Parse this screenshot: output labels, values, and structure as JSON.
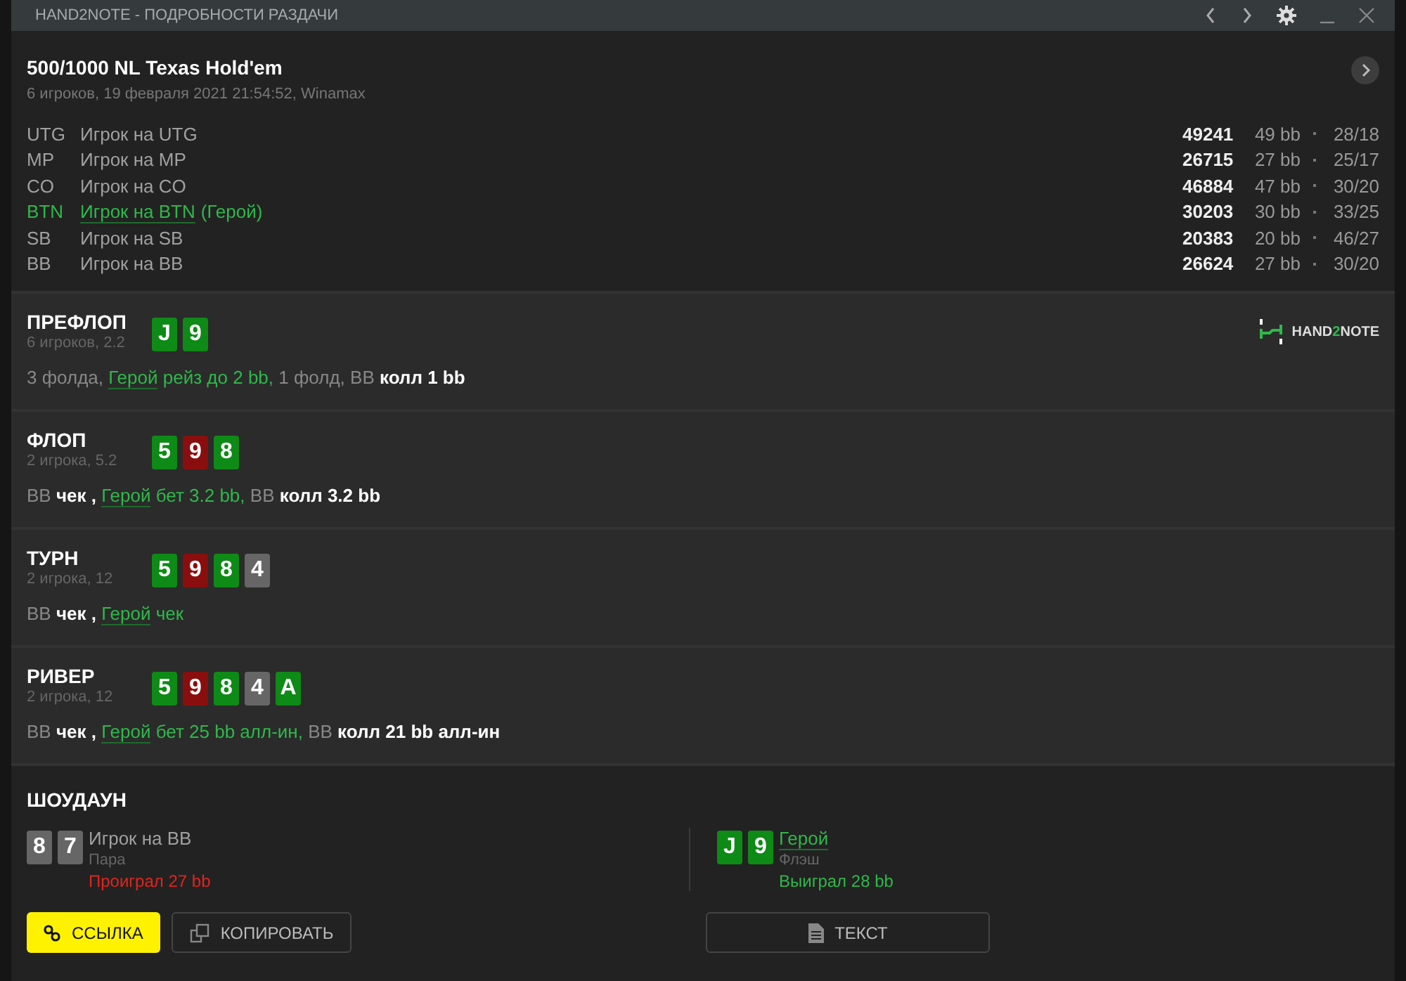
{
  "window": {
    "title": "HAND2NOTE - ПОДРОБНОСТИ РАЗДАЧИ"
  },
  "hand": {
    "title": "500/1000 NL Texas Hold'em",
    "subtitle": "6 игроков, 19 февраля 2021 21:54:52, Winamax"
  },
  "players": [
    {
      "position": "UTG",
      "name": "Игрок на UTG",
      "hero": false,
      "stack": "49241",
      "bb": "49 bb",
      "stats": "28/18"
    },
    {
      "position": "MP",
      "name": "Игрок на MP",
      "hero": false,
      "stack": "26715",
      "bb": "27 bb",
      "stats": "25/17"
    },
    {
      "position": "CO",
      "name": "Игрок на CO",
      "hero": false,
      "stack": "46884",
      "bb": "47 bb",
      "stats": "30/20"
    },
    {
      "position": "BTN",
      "name": "Игрок на BTN",
      "hero": true,
      "hero_tag": "(Герой)",
      "stack": "30203",
      "bb": "30 bb",
      "stats": "33/25"
    },
    {
      "position": "SB",
      "name": "Игрок на SB",
      "hero": false,
      "stack": "20383",
      "bb": "20 bb",
      "stats": "46/27"
    },
    {
      "position": "BB",
      "name": "Игрок на BB",
      "hero": false,
      "stack": "26624",
      "bb": "27 bb",
      "stats": "30/20"
    }
  ],
  "logo": {
    "text_a": "HAND",
    "text_b": "2",
    "text_c": "NOTE"
  },
  "streets": [
    {
      "name": "ПРЕФЛОП",
      "info": "6 игроков, 2.2",
      "cards": [
        {
          "rank": "J",
          "color": "#0e8a16"
        },
        {
          "rank": "9",
          "color": "#0e8a16"
        }
      ],
      "actions": [
        {
          "kind": "muted",
          "text": "3 фолда,"
        },
        {
          "kind": "hero",
          "text": "Герой"
        },
        {
          "kind": "hero-action",
          "text": "рейз до 2 bb,"
        },
        {
          "kind": "muted",
          "text": "1 фолд, BB"
        },
        {
          "kind": "action",
          "text": "колл 1 bb"
        }
      ]
    },
    {
      "name": "ФЛОП",
      "info": "2 игрока, 5.2",
      "cards": [
        {
          "rank": "5",
          "color": "#0e8a16"
        },
        {
          "rank": "9",
          "color": "#8a0e0e"
        },
        {
          "rank": "8",
          "color": "#0e8a16"
        }
      ],
      "actions": [
        {
          "kind": "muted",
          "text": "BB"
        },
        {
          "kind": "action",
          "text": "чек ,"
        },
        {
          "kind": "hero",
          "text": "Герой"
        },
        {
          "kind": "hero-action",
          "text": "бет 3.2 bb,"
        },
        {
          "kind": "muted",
          "text": "BB"
        },
        {
          "kind": "action",
          "text": "колл 3.2 bb"
        }
      ]
    },
    {
      "name": "ТУРН",
      "info": "2 игрока, 12",
      "cards": [
        {
          "rank": "5",
          "color": "#0e8a16"
        },
        {
          "rank": "9",
          "color": "#8a0e0e"
        },
        {
          "rank": "8",
          "color": "#0e8a16"
        },
        {
          "rank": "4",
          "color": "#666666"
        }
      ],
      "actions": [
        {
          "kind": "muted",
          "text": "BB"
        },
        {
          "kind": "action",
          "text": "чек ,"
        },
        {
          "kind": "hero",
          "text": "Герой"
        },
        {
          "kind": "hero-action",
          "text": "чек"
        }
      ]
    },
    {
      "name": "РИВЕР",
      "info": "2 игрока, 12",
      "cards": [
        {
          "rank": "5",
          "color": "#0e8a16"
        },
        {
          "rank": "9",
          "color": "#8a0e0e"
        },
        {
          "rank": "8",
          "color": "#0e8a16"
        },
        {
          "rank": "4",
          "color": "#666666"
        },
        {
          "rank": "A",
          "color": "#0e8a16"
        }
      ],
      "actions": [
        {
          "kind": "muted",
          "text": "BB"
        },
        {
          "kind": "action",
          "text": "чек ,"
        },
        {
          "kind": "hero",
          "text": "Герой"
        },
        {
          "kind": "hero-action",
          "text": "бет 25 bb алл-ин,"
        },
        {
          "kind": "muted",
          "text": "BB"
        },
        {
          "kind": "action",
          "text": "колл 21 bb алл-ин"
        }
      ]
    }
  ],
  "showdown": {
    "title": "ШОУДАУН",
    "players": [
      {
        "cards": [
          {
            "rank": "8",
            "color": "#666666"
          },
          {
            "rank": "7",
            "color": "#666666"
          }
        ],
        "name": "Игрок на BB",
        "hero": false,
        "hand": "Пара",
        "result": "Проиграл 27 bb",
        "won": false
      },
      {
        "cards": [
          {
            "rank": "J",
            "color": "#0e8a16"
          },
          {
            "rank": "9",
            "color": "#0e8a16"
          }
        ],
        "name": "Герой",
        "hero": true,
        "hand": "Флэш",
        "result": "Выиграл 28 bb",
        "won": true
      }
    ]
  },
  "buttons": [
    {
      "label": "ССЫЛКА",
      "kind": "link"
    },
    {
      "label": "КОПИРОВАТЬ",
      "kind": "copy"
    },
    {
      "label": "ТЕКСТ",
      "kind": "text"
    }
  ]
}
